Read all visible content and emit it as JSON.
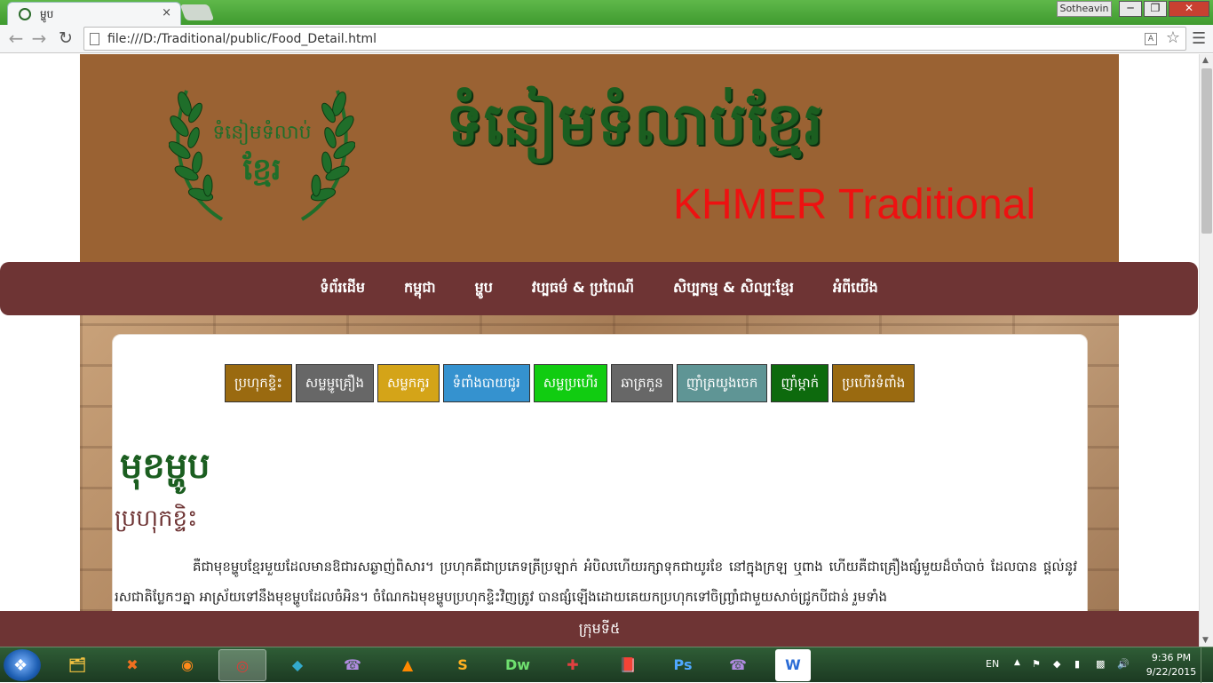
{
  "browser": {
    "tab_title": "ម្ហូប",
    "tab_close": "×",
    "url": "file:///D:/Traditional/public/Food_Detail.html",
    "user": "Sotheavin",
    "win_min": "─",
    "win_max": "❐",
    "win_close": "✕",
    "back_icon": "arrow-left-icon",
    "forward_icon": "arrow-right-icon",
    "reload_icon": "reload-icon",
    "star_icon": "star-icon",
    "menu_icon": "hamburger-icon"
  },
  "header": {
    "logo_line1": "ទំនៀមទំលាប់",
    "logo_line2": "ខ្មែរ",
    "title_kh": "ទំនៀមទំលាប់ខ្មែរ",
    "title_en": "KHMER Traditional",
    "bg_color": "#9a6233"
  },
  "nav": {
    "items": [
      {
        "label": "ទំព័រដើម"
      },
      {
        "label": "កម្ពុជា"
      },
      {
        "label": "ម្ហូប"
      },
      {
        "label": "វប្បធម៌ & ប្រពៃណី"
      },
      {
        "label": "សិប្បកម្ម & សិល្បៈខ្មែរ"
      },
      {
        "label": "អំពីយើង"
      }
    ],
    "bg_color": "#6e3434"
  },
  "categories": [
    {
      "label": "ប្រហុកខ្ទិះ",
      "color": "#9a6a10"
    },
    {
      "label": "សម្លម្ជូគ្រឿង",
      "color": "#676767"
    },
    {
      "label": "សម្លកកូរ",
      "color": "#d4a418"
    },
    {
      "label": "ទំពាំងបាយជូរ",
      "color": "#3592cf"
    },
    {
      "label": "សម្លប្រហើរ",
      "color": "#11cc11"
    },
    {
      "label": "ឆាត្រកួន",
      "color": "#676767"
    },
    {
      "label": "ញាំត្រយូងចេក",
      "color": "#5f9595"
    },
    {
      "label": "ញាំម្កាក់",
      "color": "#0d6a0d"
    },
    {
      "label": "ប្រហើរទំពាំង",
      "color": "#9a6a10"
    }
  ],
  "food": {
    "title": "មុខម្ហូប",
    "subtitle": "ប្រហុកខ្ទិះ",
    "description": "គឺជាមុខម្ហូបខ្មែរមួយដែលមានឱជារសឆ្ងាញ់ពិសារ។ ប្រហុកគឺជាប្រភេទត្រីប្រឡាក់ អំបិលហើយរក្សាទុកជាយូរខែ នៅក្នុងក្រឡ ឬពាង ហើយគឺជាគ្រឿងផ្សំមួយដ៏ចាំបាច់ ដែលបាន ផ្តល់នូវរសជាតិប្លែកៗគ្នា អាស្រ័យទៅនឹងមុខម្ហូបដែលចំអិន។ ចំណែកឯមុខម្ហូបប្រហុកខ្ទិះវិញត្រូវ បានផ្សំឡើងដោយគេយកប្រហុកទៅចិញ្ច្រាំជាមួយសាច់ជ្រូកបីជាន់ រួមទាំង"
  },
  "footer": {
    "text": "ក្រុមទី៥"
  },
  "taskbar": {
    "apps": [
      {
        "name": "explorer",
        "icon": "folder-icon",
        "glyph": "🗂"
      },
      {
        "name": "xampp",
        "icon": "xampp-icon",
        "glyph": "✖"
      },
      {
        "name": "firefox",
        "icon": "firefox-icon",
        "glyph": "◉"
      },
      {
        "name": "chrome",
        "icon": "chrome-icon",
        "glyph": "◎"
      },
      {
        "name": "bluestacks",
        "icon": "bluestacks-icon",
        "glyph": "◆"
      },
      {
        "name": "viber",
        "icon": "viber-icon",
        "glyph": "☎"
      },
      {
        "name": "vlc",
        "icon": "vlc-icon",
        "glyph": "▲"
      },
      {
        "name": "sublime",
        "icon": "sublime-icon",
        "glyph": "S"
      },
      {
        "name": "dreamweaver",
        "icon": "dreamweaver-icon",
        "glyph": "Dw"
      },
      {
        "name": "tools",
        "icon": "tools-icon",
        "glyph": "✚"
      },
      {
        "name": "dictionary",
        "icon": "book-icon",
        "glyph": "📕"
      },
      {
        "name": "photoshop",
        "icon": "photoshop-icon",
        "glyph": "Ps"
      },
      {
        "name": "viber2",
        "icon": "viber-icon",
        "glyph": "☎"
      },
      {
        "name": "word",
        "icon": "word-icon",
        "glyph": "W"
      }
    ],
    "lang": "EN",
    "time": "9:36 PM",
    "date": "9/22/2015"
  }
}
